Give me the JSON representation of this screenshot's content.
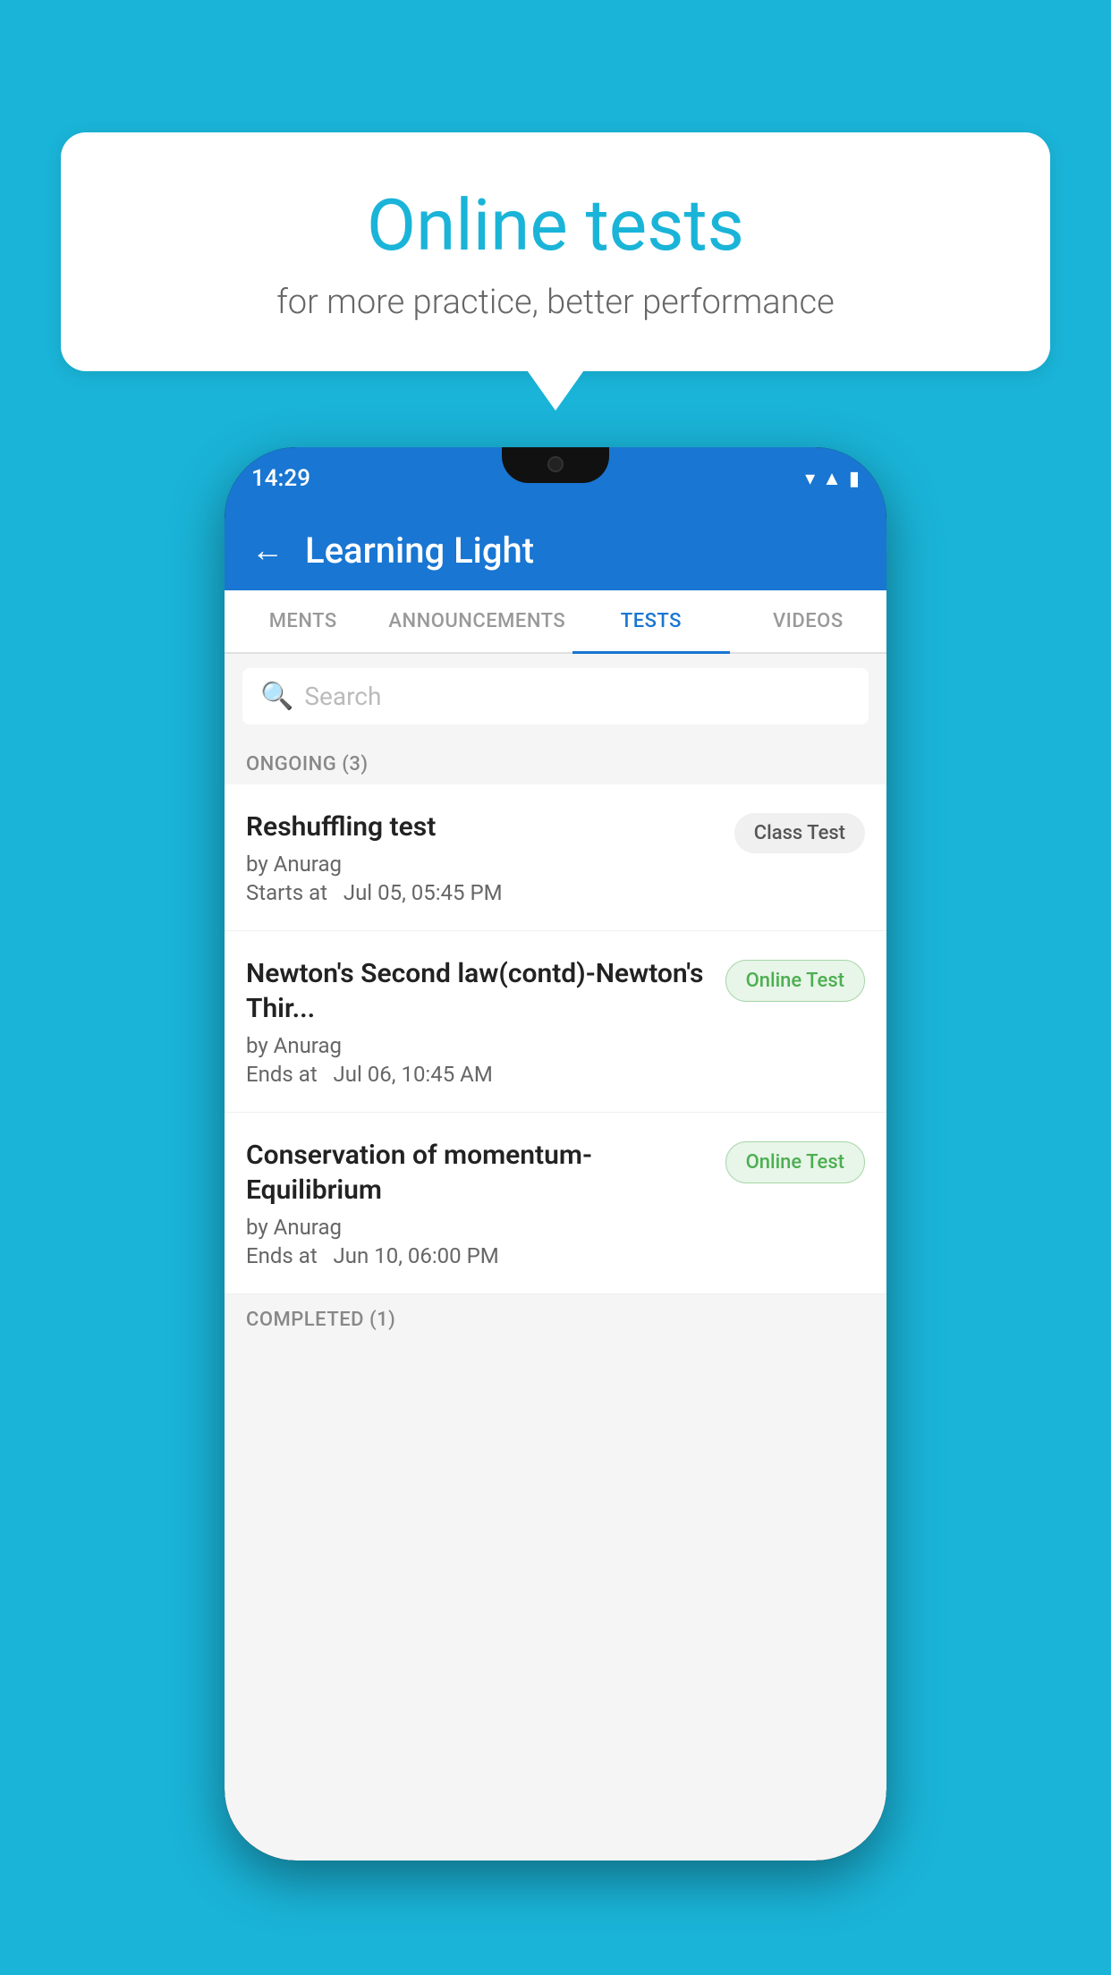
{
  "background_color": "#1ab4d8",
  "speech_bubble": {
    "title": "Online tests",
    "subtitle": "for more practice, better performance"
  },
  "phone": {
    "status_bar": {
      "time": "14:29",
      "icons": [
        "wifi",
        "signal",
        "battery"
      ]
    },
    "app_bar": {
      "back_label": "←",
      "title": "Learning Light"
    },
    "tabs": [
      {
        "label": "MENTS",
        "active": false
      },
      {
        "label": "ANNOUNCEMENTS",
        "active": false
      },
      {
        "label": "TESTS",
        "active": true
      },
      {
        "label": "VIDEOS",
        "active": false
      }
    ],
    "search": {
      "placeholder": "Search"
    },
    "sections": [
      {
        "label": "ONGOING (3)",
        "tests": [
          {
            "title": "Reshuffling test",
            "by": "by Anurag",
            "time_label": "Starts at",
            "time": "Jul 05, 05:45 PM",
            "badge": "Class Test",
            "badge_type": "class"
          },
          {
            "title": "Newton's Second law(contd)-Newton's Thir...",
            "by": "by Anurag",
            "time_label": "Ends at",
            "time": "Jul 06, 10:45 AM",
            "badge": "Online Test",
            "badge_type": "online"
          },
          {
            "title": "Conservation of momentum-Equilibrium",
            "by": "by Anurag",
            "time_label": "Ends at",
            "time": "Jun 10, 06:00 PM",
            "badge": "Online Test",
            "badge_type": "online"
          }
        ]
      },
      {
        "label": "COMPLETED (1)",
        "tests": []
      }
    ]
  }
}
